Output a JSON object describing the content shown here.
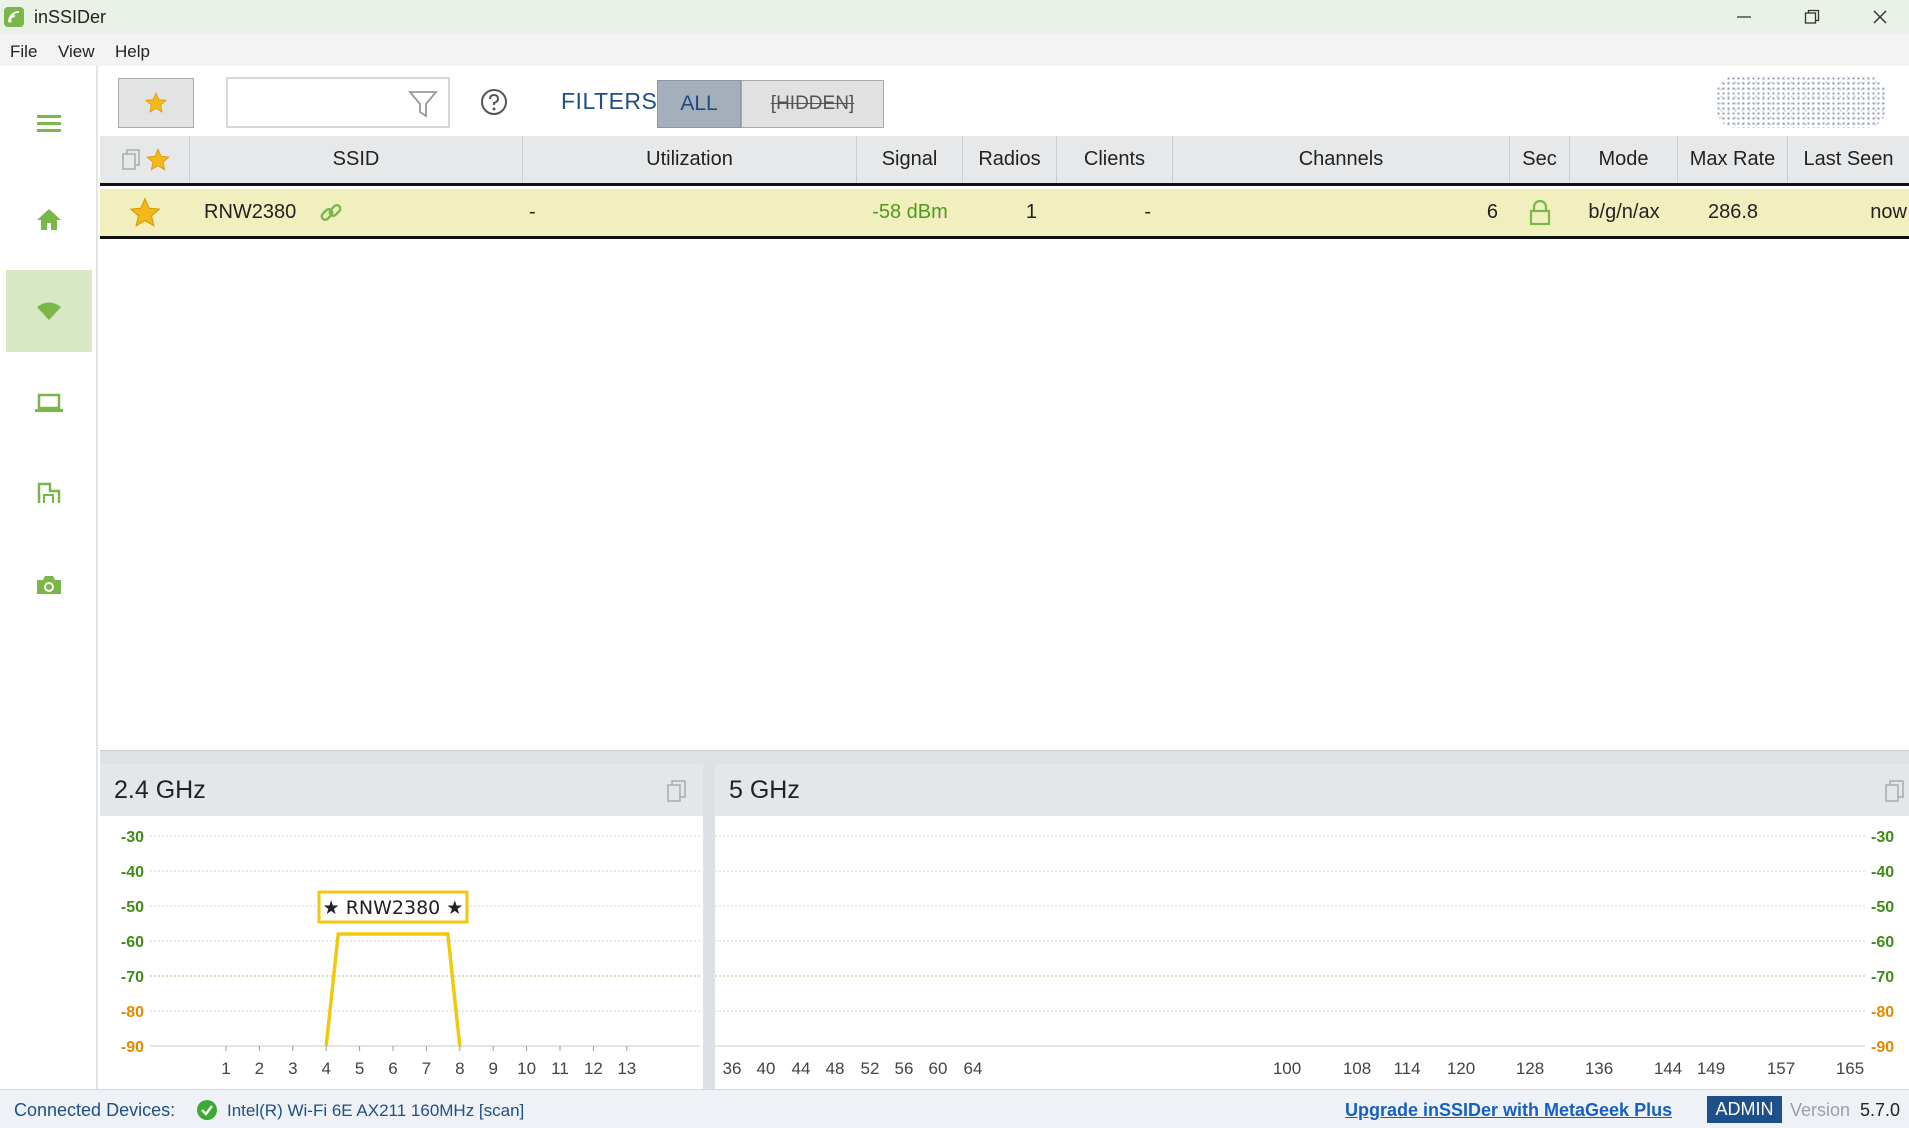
{
  "window": {
    "title": "inSSIDer"
  },
  "menu": {
    "items": [
      "File",
      "View",
      "Help"
    ]
  },
  "sidebar": {
    "items": [
      {
        "name": "menu",
        "icon": "hamburger-icon"
      },
      {
        "name": "home",
        "icon": "home-icon"
      },
      {
        "name": "wifi",
        "icon": "wifi-icon",
        "active": true
      },
      {
        "name": "laptop",
        "icon": "laptop-icon"
      },
      {
        "name": "floorplan",
        "icon": "floorplan-icon"
      },
      {
        "name": "camera",
        "icon": "camera-icon"
      }
    ]
  },
  "toolbar": {
    "search": {
      "value": "",
      "placeholder": ""
    },
    "filters_label": "FILTERS:",
    "filter_all": "ALL",
    "filter_hidden": "[HIDDEN]"
  },
  "table": {
    "columns": [
      "SSID",
      "Utilization",
      "Signal",
      "Radios",
      "Clients",
      "Channels",
      "Sec",
      "Mode",
      "Max Rate",
      "Last Seen"
    ],
    "rows": [
      {
        "ssid": "RNW2380",
        "utilization": "-",
        "signal": "-58 dBm",
        "radios": "1",
        "clients": "-",
        "channels": "6",
        "mode": "b/g/n/ax",
        "max_rate": "286.8",
        "last_seen": "now"
      }
    ]
  },
  "charts": {
    "band24": {
      "title": "2.4 GHz"
    },
    "band5": {
      "title": "5 GHz"
    }
  },
  "chart_data": [
    {
      "type": "area",
      "title": "2.4 GHz",
      "y_ticks": [
        -30,
        -40,
        -50,
        -60,
        -70,
        -80,
        -90
      ],
      "ylim": [
        -90,
        -30
      ],
      "x_ticks": [
        "1",
        "2",
        "3",
        "4",
        "5",
        "6",
        "7",
        "8",
        "9",
        "10",
        "11",
        "12",
        "13"
      ],
      "xlim": [
        1,
        13
      ],
      "series": [
        {
          "name": "★ RNW2380 ★",
          "channel": 6,
          "channel_span": [
            4,
            8
          ],
          "signal": -58,
          "color": "#f2c80f"
        }
      ]
    },
    {
      "type": "area",
      "title": "5 GHz",
      "y_ticks": [
        -30,
        -40,
        -50,
        -60,
        -70,
        -80,
        -90
      ],
      "ylim": [
        -90,
        -30
      ],
      "x_ticks": [
        "36",
        "40",
        "44",
        "48",
        "52",
        "56",
        "60",
        "64",
        "100",
        "108",
        "114",
        "120",
        "128",
        "136",
        "144",
        "149",
        "157",
        "165"
      ],
      "series": []
    }
  ],
  "status": {
    "label": "Connected Devices:",
    "device": "Intel(R) Wi-Fi 6E AX211 160MHz [scan]",
    "upgrade": "Upgrade inSSIDer with MetaGeek Plus",
    "admin": "ADMIN",
    "version_label": "Version",
    "version": "5.7.0"
  },
  "colors": {
    "accent_green": "#7ab648",
    "row_highlight": "#f2efbf",
    "signal_green": "#4f9a1d",
    "trace_yellow": "#f2c80f",
    "brand_blue": "#1e4f86"
  }
}
